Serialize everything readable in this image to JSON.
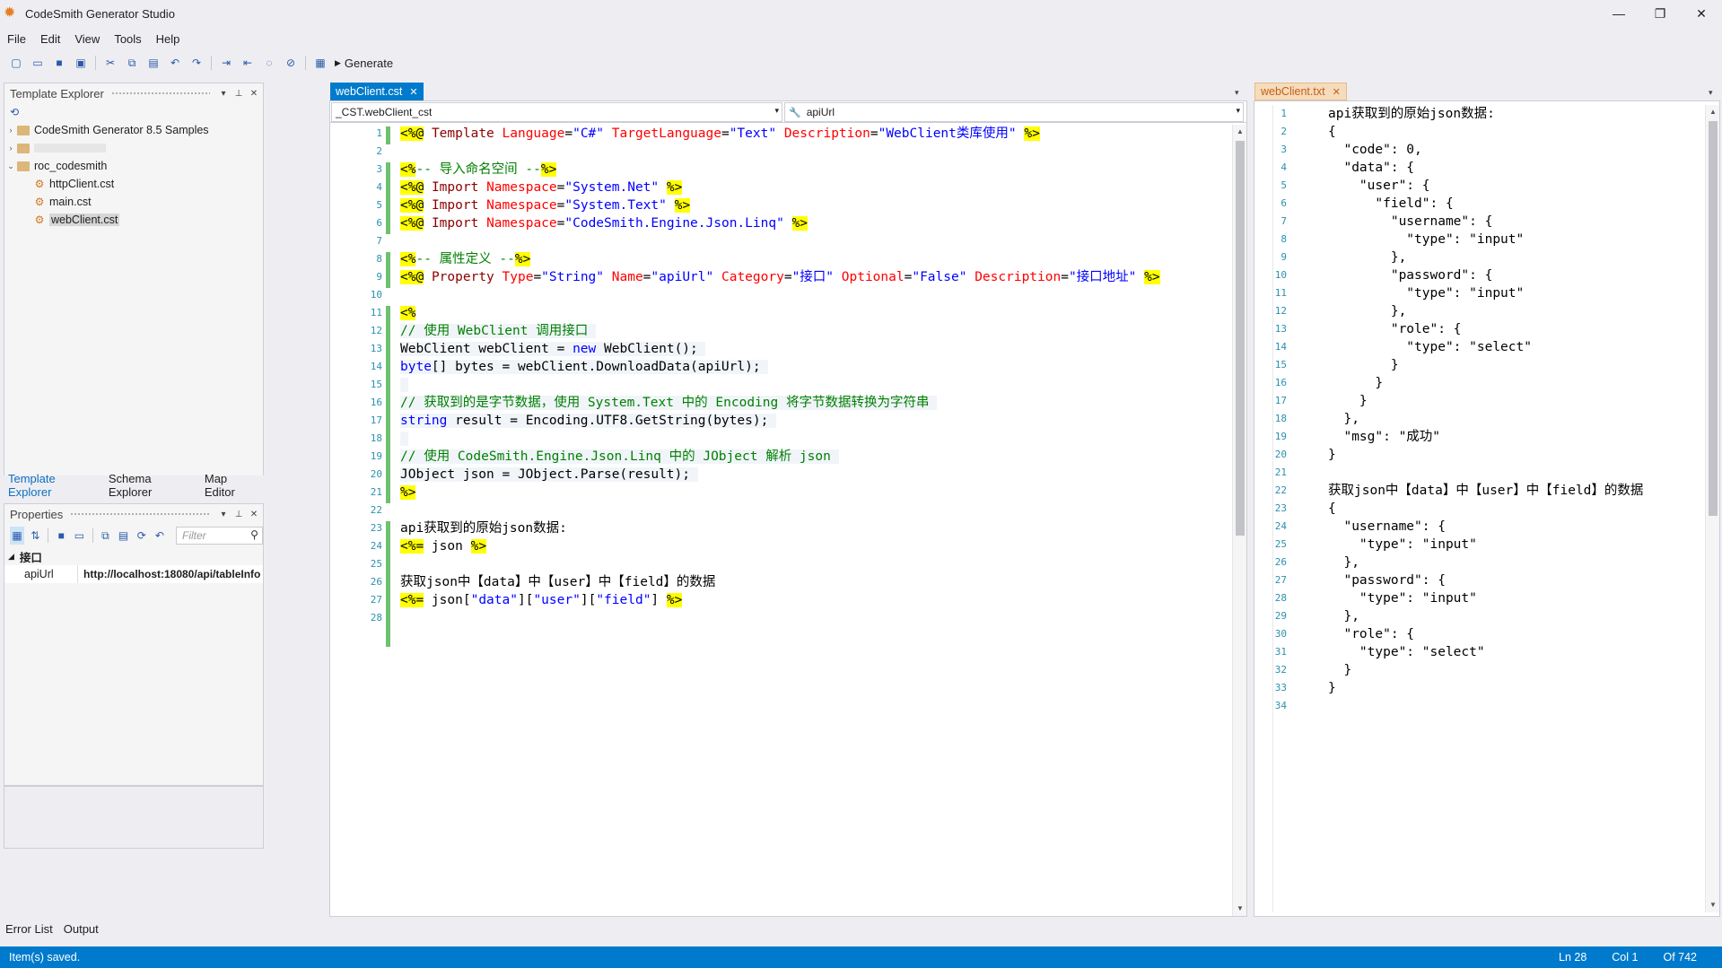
{
  "window": {
    "title": "CodeSmith Generator Studio",
    "controls": [
      "—",
      "❐",
      "✕"
    ]
  },
  "menu": [
    "File",
    "Edit",
    "View",
    "Tools",
    "Help"
  ],
  "toolbar": {
    "generate_label": "Generate"
  },
  "template_explorer": {
    "title": "Template Explorer",
    "tree": [
      {
        "label": "CodeSmith Generator 8.5 Samples",
        "type": "folder",
        "level": 0,
        "expanded": false
      },
      {
        "label": "",
        "type": "folder",
        "level": 0,
        "expanded": false
      },
      {
        "label": "roc_codesmith",
        "type": "folder",
        "level": 0,
        "expanded": true
      },
      {
        "label": "httpClient.cst",
        "type": "file",
        "level": 1
      },
      {
        "label": "main.cst",
        "type": "file",
        "level": 1
      },
      {
        "label": "webClient.cst",
        "type": "file",
        "level": 1,
        "selected": true
      }
    ]
  },
  "left_tabs": [
    "Template Explorer",
    "Schema Explorer",
    "Map Editor"
  ],
  "properties": {
    "title": "Properties",
    "filter_placeholder": "Filter",
    "category": "接口",
    "rows": [
      {
        "name": "apiUrl",
        "value": "http://localhost:18080/api/tableInfo"
      }
    ]
  },
  "bottom_tabs": [
    "Error List",
    "Output"
  ],
  "editor": {
    "tab": "webClient.cst",
    "class_combo": "_CST.webClient_cst",
    "member_combo": "apiUrl",
    "lines": [
      "1",
      "2",
      "3",
      "4",
      "5",
      "6",
      "7",
      "8",
      "9",
      "10",
      "11",
      "12",
      "13",
      "14",
      "15",
      "16",
      "17",
      "18",
      "19",
      "20",
      "21",
      "22",
      "23",
      "24",
      "25",
      "26",
      "27",
      "28"
    ]
  },
  "right_editor": {
    "tab": "webClient.txt",
    "lines": [
      "api获取到的原始json数据:",
      "{",
      "  \"code\": 0,",
      "  \"data\": {",
      "    \"user\": {",
      "      \"field\": {",
      "        \"username\": {",
      "          \"type\": \"input\"",
      "        },",
      "        \"password\": {",
      "          \"type\": \"input\"",
      "        },",
      "        \"role\": {",
      "          \"type\": \"select\"",
      "        }",
      "      }",
      "    }",
      "  },",
      "  \"msg\": \"成功\"",
      "}",
      "",
      "获取json中【data】中【user】中【field】的数据",
      "{",
      "  \"username\": {",
      "    \"type\": \"input\"",
      "  },",
      "  \"password\": {",
      "    \"type\": \"input\"",
      "  },",
      "  \"role\": {",
      "    \"type\": \"select\"",
      "  }",
      "}",
      ""
    ]
  },
  "status": {
    "message": "Item(s) saved.",
    "ln": "Ln 28",
    "col": "Col 1",
    "of": "Of 742"
  },
  "colors": {
    "accent": "#007acc",
    "delimiter_highlight": "#ffff00",
    "change_bar": "#6ec16e"
  }
}
